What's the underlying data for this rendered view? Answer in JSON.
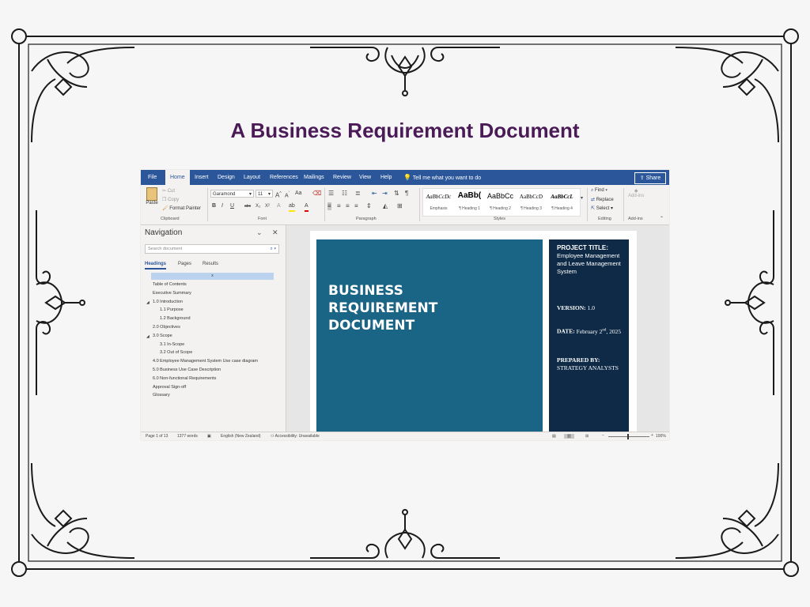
{
  "slide": {
    "title": "A Business Requirement Document"
  },
  "word": {
    "tabs": [
      "File",
      "Home",
      "Insert",
      "Design",
      "Layout",
      "References",
      "Mailings",
      "Review",
      "View",
      "Help"
    ],
    "active_tab": "Home",
    "tell_me": "Tell me what you want to do",
    "share": "Share",
    "ribbon": {
      "clipboard": {
        "label": "Clipboard",
        "paste": "Paste",
        "cut": "Cut",
        "copy": "Copy",
        "format_painter": "Format Painter"
      },
      "font": {
        "label": "Font",
        "font_name": "Garamond",
        "font_size": "11",
        "bold": "B",
        "italic": "I",
        "underline": "U",
        "strike": "abc",
        "sub": "X₂",
        "sup": "X²",
        "grow": "A",
        "shrink": "A",
        "case": "Aa"
      },
      "paragraph": {
        "label": "Paragraph"
      },
      "styles": {
        "label": "Styles",
        "items": [
          {
            "sample": "AaBbCcDc",
            "name": "Emphasis"
          },
          {
            "sample": "AaBb(",
            "name": "¶ Heading 1"
          },
          {
            "sample": "AaBbCc",
            "name": "¶ Heading 2"
          },
          {
            "sample": "AaBbCcD",
            "name": "¶ Heading 3"
          },
          {
            "sample": "AaBbCcL",
            "name": "¶ Heading 4"
          }
        ]
      },
      "editing": {
        "label": "Editing",
        "find": "Find",
        "replace": "Replace",
        "select": "Select"
      },
      "addins": {
        "label": "Add-ins",
        "button": "Add-ins"
      }
    },
    "navigation": {
      "title": "Navigation",
      "search_placeholder": "Search document",
      "tabs": [
        "Headings",
        "Pages",
        "Results"
      ],
      "active_tab": "Headings",
      "selected_marker": "x",
      "headings": [
        {
          "text": "Table of Contents",
          "level": 1,
          "caret": ""
        },
        {
          "text": "Executive Summary",
          "level": 1,
          "caret": ""
        },
        {
          "text": "1.0 Introduction",
          "level": 1,
          "caret": "◢"
        },
        {
          "text": "1.1 Purpose",
          "level": 2,
          "caret": ""
        },
        {
          "text": "1.2 Background",
          "level": 2,
          "caret": ""
        },
        {
          "text": "2.0 Objectives",
          "level": 1,
          "caret": ""
        },
        {
          "text": "3.0 Scope",
          "level": 1,
          "caret": "◢"
        },
        {
          "text": "3.1 In-Scope",
          "level": 2,
          "caret": ""
        },
        {
          "text": "3.2 Out of Scope",
          "level": 2,
          "caret": ""
        },
        {
          "text": "4.0 Employee Management System Use case diagram",
          "level": 1,
          "caret": ""
        },
        {
          "text": "5.0 Business Use Case Description",
          "level": 1,
          "caret": ""
        },
        {
          "text": "6.0 Non-functional Requirements",
          "level": 1,
          "caret": ""
        },
        {
          "text": "Approval Sign-off",
          "level": 1,
          "caret": ""
        },
        {
          "text": "Glossary",
          "level": 1,
          "caret": ""
        }
      ]
    },
    "document": {
      "cover_title": [
        "BUSINESS",
        "REQUIREMENT",
        "DOCUMENT"
      ],
      "project_label": "PROJECT TITLE:",
      "project_value": "Employee Management and Leave Management System",
      "version_label": "VERSION:",
      "version_value": "1.0",
      "date_label": "DATE:",
      "date_value": "February 2nd, 2025",
      "prepared_label": "PREPARED BY:",
      "prepared_value": "STRATEGY ANALYSTS"
    },
    "status": {
      "page": "Page 1 of 13",
      "words": "1377 words",
      "language": "English (New Zealand)",
      "accessibility": "Accessibility: Unavailable",
      "zoom": "100%"
    }
  }
}
